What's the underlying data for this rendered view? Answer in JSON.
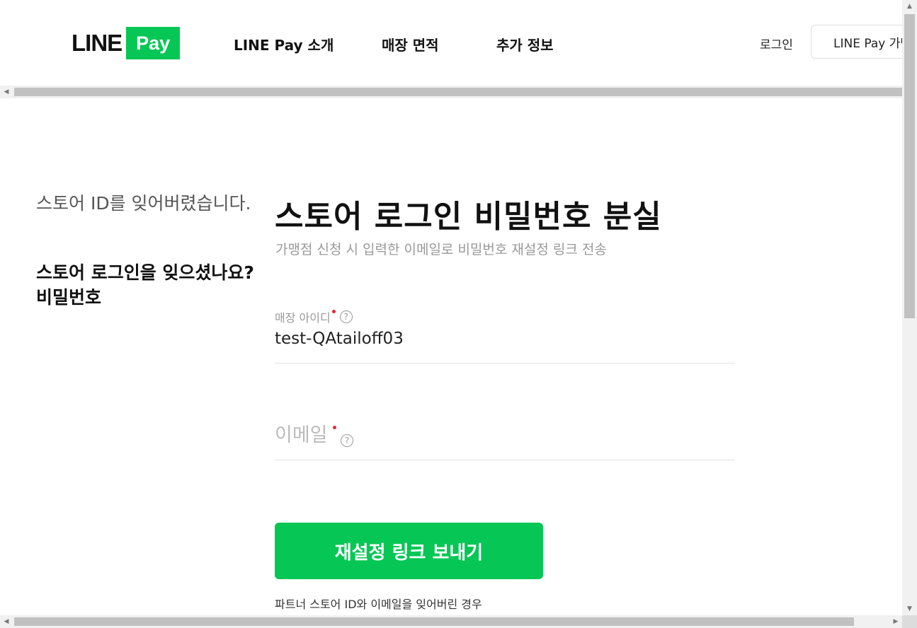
{
  "header": {
    "logo_text": "LINE",
    "logo_badge": "Pay",
    "nav": [
      {
        "label": "LINE Pay 소개"
      },
      {
        "label": "매장 면적"
      },
      {
        "label": "추가 정보"
      }
    ],
    "login_label": "로그인",
    "join_label": "LINE Pay 가맹점"
  },
  "sidebar": {
    "link_label": "스토어 ID를 잊어버렸습니다.",
    "current_line1": "스토어 로그인을 잊으셨나요?",
    "current_line2": "비밀번호"
  },
  "main": {
    "title": "스토어 로그인 비밀번호 분실",
    "subtitle": "가맹점 신청 시 입력한 이메일로 비밀번호 재설정 링크 전송",
    "store_id": {
      "label": "매장 아이디",
      "value": "test-QAtailoff03"
    },
    "email": {
      "placeholder": "이메일",
      "value": ""
    },
    "help_glyph": "?",
    "submit_label": "재설정 링크 보내기",
    "note": "파트너 스토어 ID와 이메일을 잊어버린 경우"
  },
  "colors": {
    "brand_green": "#06c755",
    "required_dot": "#e0282f"
  }
}
